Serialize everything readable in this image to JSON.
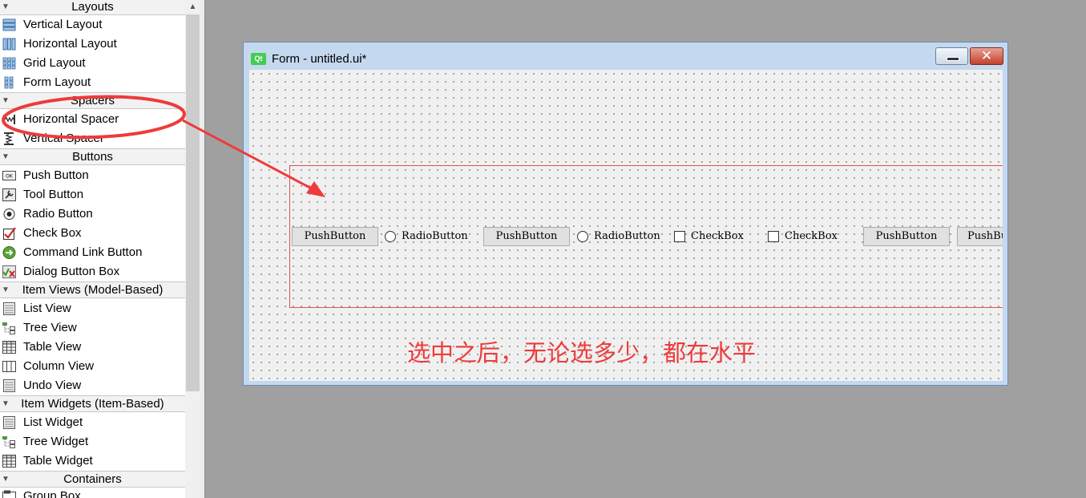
{
  "widget_box": {
    "categories": {
      "layouts": "Layouts",
      "spacers": "Spacers",
      "buttons": "Buttons",
      "item_views": "Item Views (Model-Based)",
      "item_widgets": "Item Widgets (Item-Based)",
      "containers": "Containers"
    },
    "items": {
      "vertical_layout": "Vertical Layout",
      "horizontal_layout": "Horizontal Layout",
      "grid_layout": "Grid Layout",
      "form_layout": "Form Layout",
      "horizontal_spacer": "Horizontal Spacer",
      "vertical_spacer": "Vertical Spacer",
      "push_button": "Push Button",
      "tool_button": "Tool Button",
      "radio_button": "Radio Button",
      "check_box": "Check Box",
      "command_link_button": "Command Link Button",
      "dialog_button_box": "Dialog Button Box",
      "list_view": "List View",
      "tree_view": "Tree View",
      "table_view": "Table View",
      "column_view": "Column View",
      "undo_view": "Undo View",
      "list_widget": "List Widget",
      "tree_widget": "Tree Widget",
      "table_widget": "Table Widget",
      "group_box": "Group Box"
    }
  },
  "form": {
    "qt_logo": "Qt",
    "title": "Form - untitled.ui*",
    "close_glyph": "✕",
    "widgets": {
      "push_button_1": "PushButton",
      "radio_button_1": "RadioButton",
      "push_button_2": "PushButton",
      "radio_button_2": "RadioButton",
      "check_box_1": "CheckBox",
      "check_box_2": "CheckBox",
      "push_button_3": "PushButton",
      "push_button_4": "PushButton"
    }
  },
  "annotation": {
    "text": "选中之后，无论选多少，都在水平"
  },
  "colors": {
    "annotation_red": "#ee3b3b",
    "layout_border": "#e05050",
    "qt_green": "#41cd52"
  }
}
